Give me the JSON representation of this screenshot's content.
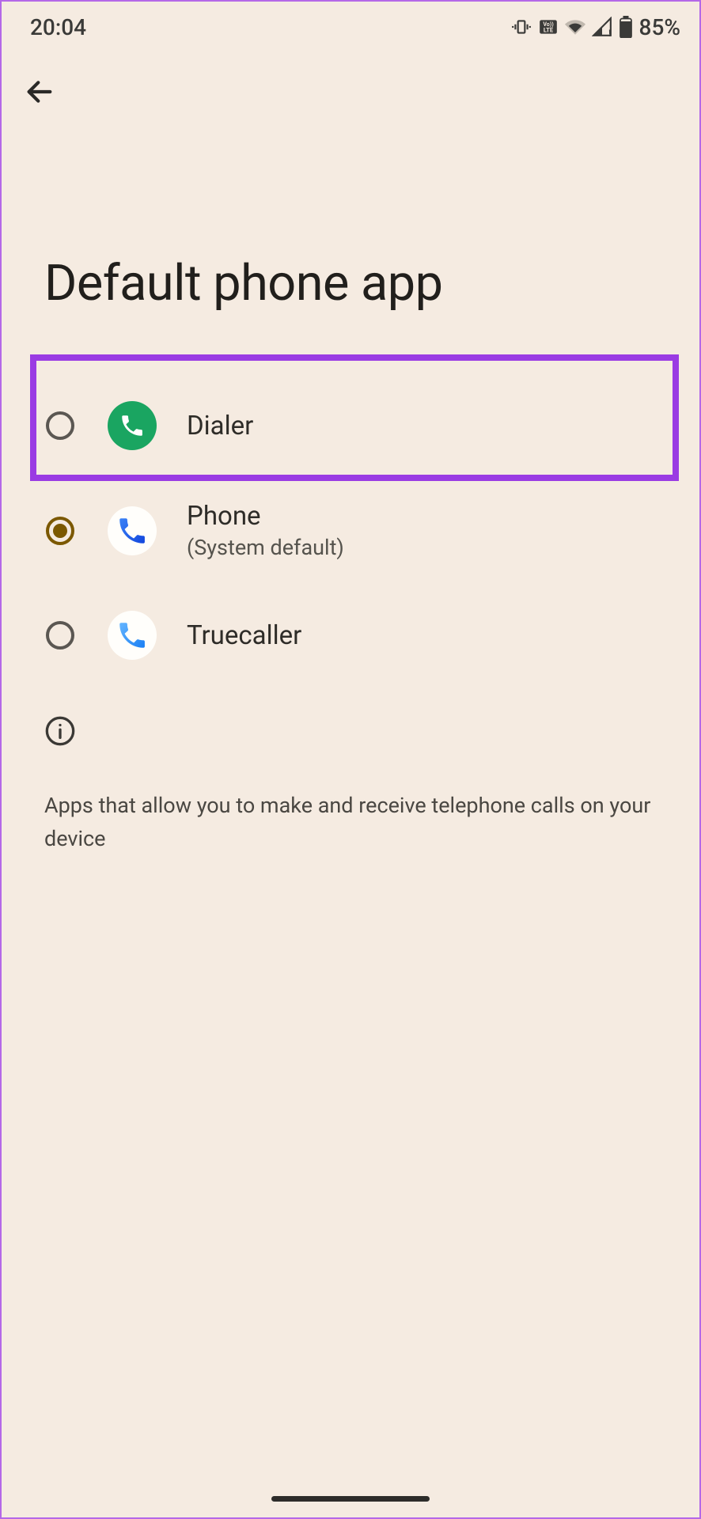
{
  "status": {
    "time": "20:04",
    "battery_pct": "85%"
  },
  "page": {
    "title": "Default phone app"
  },
  "options": [
    {
      "label": "Dialer",
      "sublabel": "",
      "selected": false,
      "icon_type": "green"
    },
    {
      "label": "Phone",
      "sublabel": "(System default)",
      "selected": true,
      "icon_type": "blue"
    },
    {
      "label": "Truecaller",
      "sublabel": "",
      "selected": false,
      "icon_type": "blue"
    }
  ],
  "info": {
    "text": "Apps that allow you to make and receive telephone calls on your device"
  }
}
